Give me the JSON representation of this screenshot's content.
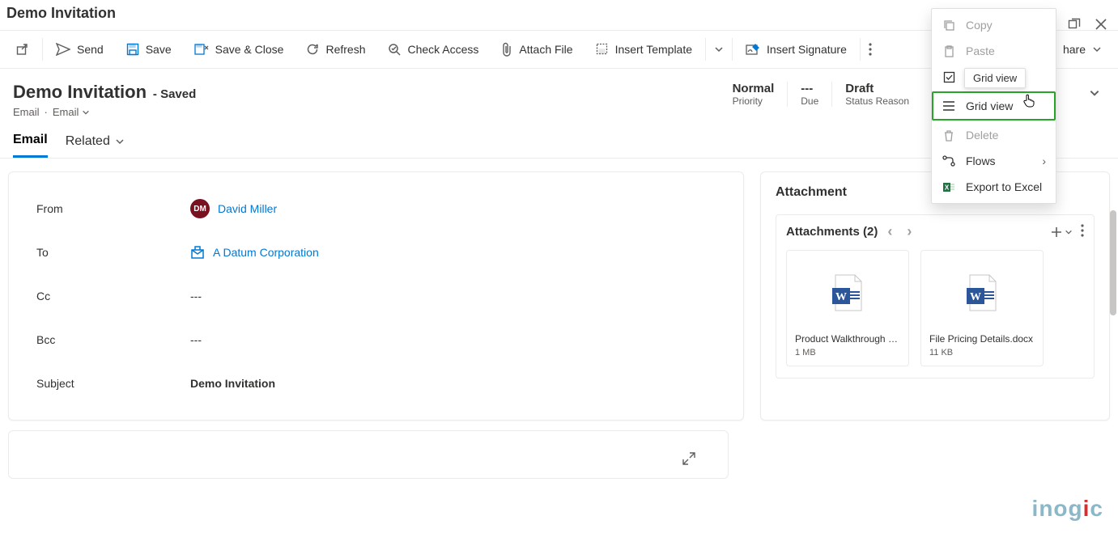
{
  "window_title": "Demo Invitation",
  "toolbar": {
    "send": "Send",
    "save": "Save",
    "save_close": "Save & Close",
    "refresh": "Refresh",
    "check_access": "Check Access",
    "attach_file": "Attach File",
    "insert_template": "Insert Template",
    "insert_signature": "Insert Signature",
    "share": "hare"
  },
  "record": {
    "title": "Demo Invitation",
    "saved": "- Saved",
    "entity": "Email",
    "form": "Email"
  },
  "status": {
    "priority_val": "Normal",
    "priority_lab": "Priority",
    "due_val": "---",
    "due_lab": "Due",
    "reason_val": "Draft",
    "reason_lab": "Status Reason"
  },
  "tabs": {
    "email": "Email",
    "related": "Related"
  },
  "form": {
    "from_lab": "From",
    "from_initials": "DM",
    "from_name": "David Miller",
    "to_lab": "To",
    "to_name": "A Datum Corporation",
    "cc_lab": "Cc",
    "cc_val": "---",
    "bcc_lab": "Bcc",
    "bcc_val": "---",
    "subject_lab": "Subject",
    "subject_val": "Demo Invitation"
  },
  "attachment_panel": {
    "heading": "Attachment",
    "subheading": "Attachments (2)",
    "items": [
      {
        "name": "Product Walkthrough Det...",
        "size": "1 MB"
      },
      {
        "name": "File Pricing Details.docx",
        "size": "11 KB"
      }
    ]
  },
  "context_menu": {
    "copy": "Copy",
    "paste": "Paste",
    "select_all": "Select All",
    "grid_view": "Grid view",
    "delete": "Delete",
    "flows": "Flows",
    "export": "Export to Excel",
    "tooltip": "Grid view"
  },
  "brand": "inogic"
}
